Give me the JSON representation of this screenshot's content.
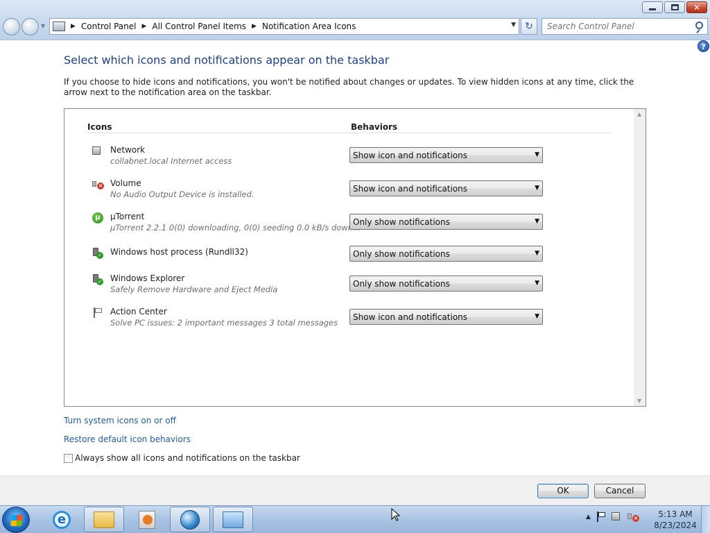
{
  "window": {
    "minimize_icon": "minimize-icon",
    "maximize_icon": "restore-icon",
    "close_icon": "close-icon"
  },
  "nav": {
    "breadcrumbs": [
      "Control Panel",
      "All Control Panel Items",
      "Notification Area Icons"
    ],
    "search_placeholder": "Search Control Panel",
    "refresh_glyph": "↻"
  },
  "help": {
    "label": "?"
  },
  "main": {
    "title": "Select which icons and notifications appear on the taskbar",
    "intro": "If you choose to hide icons and notifications, you won't be notified about changes or updates. To view hidden icons at any time, click the arrow next to the notification area on the taskbar.",
    "columns": {
      "icons": "Icons",
      "behaviors": "Behaviors"
    },
    "items": [
      {
        "name": "Network",
        "description": "collabnet.local Internet access",
        "behavior": "Show icon and notifications",
        "icon": "network-icon"
      },
      {
        "name": "Volume",
        "description": "No Audio Output Device is installed.",
        "behavior": "Show icon and notifications",
        "icon": "volume-muted-icon"
      },
      {
        "name": "µTorrent",
        "description": "µTorrent 2.2.1  0(0) downloading, 0(0) seeding  0.0 kB/s down...",
        "behavior": "Only show notifications",
        "icon": "utorrent-icon"
      },
      {
        "name": "Windows host process (Rundll32)",
        "description": "",
        "behavior": "Only show notifications",
        "icon": "device-check-icon"
      },
      {
        "name": "Windows Explorer",
        "description": "Safely Remove Hardware and Eject Media",
        "behavior": "Only show notifications",
        "icon": "device-check-icon"
      },
      {
        "name": "Action Center",
        "description": "Solve PC issues: 2 important messages  3 total messages",
        "behavior": "Show icon and notifications",
        "icon": "flag-icon"
      }
    ],
    "links": {
      "system_icons": "Turn system icons on or off",
      "restore_defaults": "Restore default icon behaviors"
    },
    "always_show": {
      "label": "Always show all icons and notifications on the taskbar",
      "checked": false
    }
  },
  "footer": {
    "ok": "OK",
    "cancel": "Cancel"
  },
  "taskbar": {
    "time": "5:13 AM",
    "date": "8/23/2024"
  },
  "colors": {
    "title_blue": "#1e3f8a",
    "link_blue": "#1f5aa5",
    "taskbar": "#a9c3e3"
  }
}
